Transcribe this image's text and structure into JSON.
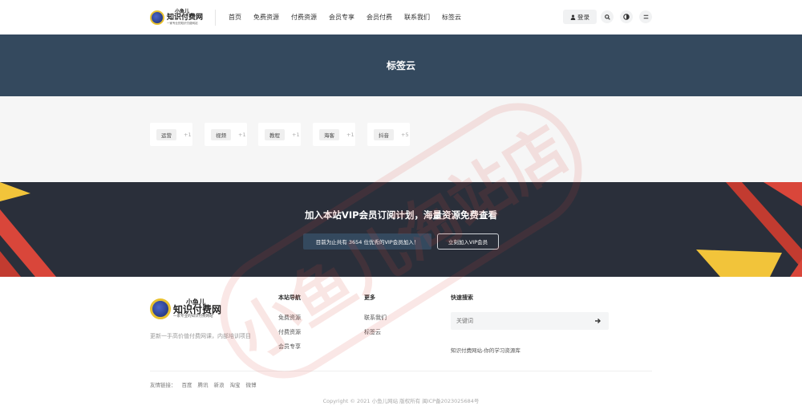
{
  "header": {
    "logo": {
      "line1": "小鱼儿",
      "line2": "知识付费网",
      "line3": "一家专业的知识付费网站"
    },
    "nav": [
      "首页",
      "免费资源",
      "付费资源",
      "会员专享",
      "会员付费",
      "联系我们",
      "标签云"
    ],
    "login_label": "登录"
  },
  "banner": {
    "title": "标签云"
  },
  "tags": [
    {
      "name": "运营",
      "count": "+1"
    },
    {
      "name": "视频",
      "count": "+1"
    },
    {
      "name": "教程",
      "count": "+1"
    },
    {
      "name": "海客",
      "count": "+1"
    },
    {
      "name": "抖音",
      "count": "+5"
    }
  ],
  "vip": {
    "title": "加入本站VIP会员订阅计划，海量资源免费查看",
    "count_text": "目前为止共有 3654 位优秀的VIP会员加入！",
    "join_label": "立刻加入VIP会员"
  },
  "footer": {
    "logo": {
      "line1": "小鱼儿",
      "line2": "知识付费网",
      "line3": "一家专业的知识付费网站"
    },
    "desc": "更新一手高价值付费网课，内部培训项目",
    "col1": {
      "title": "本站导航",
      "links": [
        "免费资源",
        "付费资源",
        "会员专享"
      ]
    },
    "col2": {
      "title": "更多",
      "links": [
        "联系我们",
        "标签云"
      ]
    },
    "search": {
      "title": "快速搜索",
      "placeholder": "关键词",
      "desc": "知识付费网站-你的学习资源库"
    },
    "friend_links": [
      "友情链接：",
      "百度",
      "腾讯",
      "新浪",
      "淘宝",
      "微博"
    ],
    "copyright": "Copyright © 2021 小鱼儿网站 版权所有 闽ICP备2023025684号"
  },
  "watermark": {
    "text": "小鱼儿淘站店"
  },
  "colors": {
    "banner": "#34495e",
    "vip_bg": "#2a2f3a",
    "accent_red": "#d9463a",
    "accent_yellow": "#f2c43a"
  }
}
